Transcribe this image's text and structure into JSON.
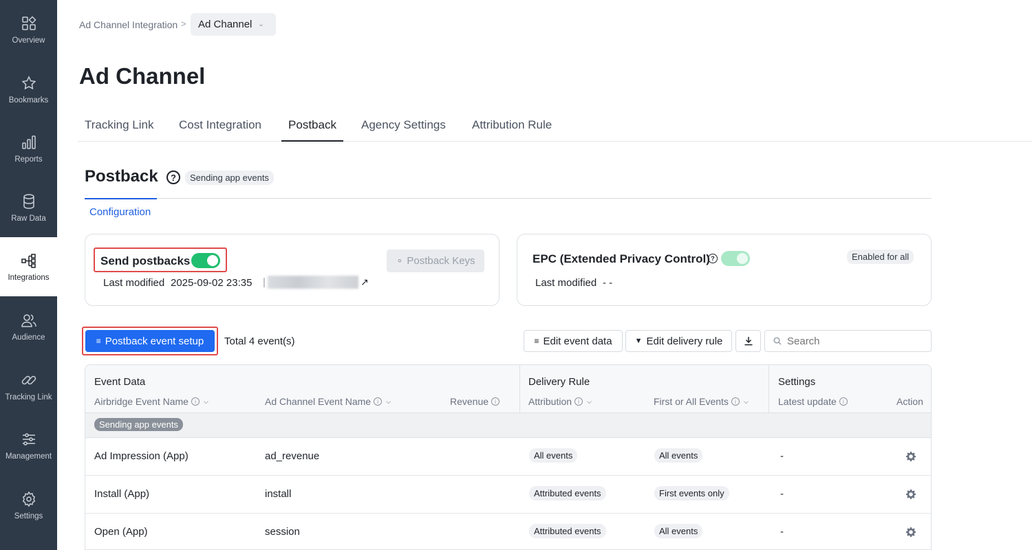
{
  "sidebar": {
    "items": [
      {
        "label": "Overview",
        "icon": "grid-icon"
      },
      {
        "label": "Bookmarks",
        "icon": "star-icon"
      },
      {
        "label": "Reports",
        "icon": "bar-chart-icon"
      },
      {
        "label": "Raw Data",
        "icon": "database-icon"
      },
      {
        "label": "Integrations",
        "icon": "integration-icon",
        "active": true
      },
      {
        "label": "Audience",
        "icon": "people-icon"
      },
      {
        "label": "Tracking Link",
        "icon": "link-icon"
      },
      {
        "label": "Management",
        "icon": "sliders-icon"
      },
      {
        "label": "Settings",
        "icon": "gear-icon"
      }
    ]
  },
  "breadcrumb": {
    "parent": "Ad Channel Integration",
    "separator": ">",
    "current": "Ad Channel"
  },
  "page_title": "Ad Channel",
  "tabs": [
    "Tracking Link",
    "Cost Integration",
    "Postback",
    "Agency Settings",
    "Attribution Rule"
  ],
  "active_tab": "Postback",
  "section": {
    "title": "Postback",
    "help": "?",
    "badge": "Sending app events",
    "subtab": "Configuration"
  },
  "send_card": {
    "label": "Send postbacks",
    "enabled": true,
    "last_modified_label": "Last modified",
    "last_modified_value": "2025-09-02 23:35",
    "separator": "|",
    "link_arrow": "↗",
    "keys_button": "Postback Keys"
  },
  "epc_card": {
    "label": "EPC (Extended Privacy Control)",
    "help": "?",
    "enabled": true,
    "badge": "Enabled for all",
    "last_modified_label": "Last modified",
    "last_modified_value": "- -"
  },
  "toolbar": {
    "setup_button": "Postback event setup",
    "total": "Total 4 event(s)",
    "edit_event_data": "Edit event data",
    "edit_delivery_rule": "Edit delivery rule",
    "search_placeholder": "Search"
  },
  "table": {
    "groups": {
      "event_data": "Event Data",
      "delivery_rule": "Delivery Rule",
      "settings": "Settings"
    },
    "columns": {
      "airbridge_event": "Airbridge Event Name",
      "channel_event": "Ad Channel Event Name",
      "revenue": "Revenue",
      "attribution": "Attribution",
      "first_or_all": "First or All Events",
      "latest_update": "Latest update",
      "action": "Action"
    },
    "group_label": "Sending app events",
    "rows": [
      {
        "event": "Ad Impression (App)",
        "channel_event": "ad_revenue",
        "attribution": "All events",
        "first_or_all": "All events",
        "latest_update": "-"
      },
      {
        "event": "Install (App)",
        "channel_event": "install",
        "attribution": "Attributed events",
        "first_or_all": "First events only",
        "latest_update": "-"
      },
      {
        "event": "Open (App)",
        "channel_event": "session",
        "attribution": "Attributed events",
        "first_or_all": "All events",
        "latest_update": "-"
      }
    ]
  },
  "colors": {
    "sidebar_bg": "#2f3a48",
    "accent": "#1f6af0",
    "toggle_on": "#1fbf6f",
    "highlight": "#e04b4b"
  }
}
